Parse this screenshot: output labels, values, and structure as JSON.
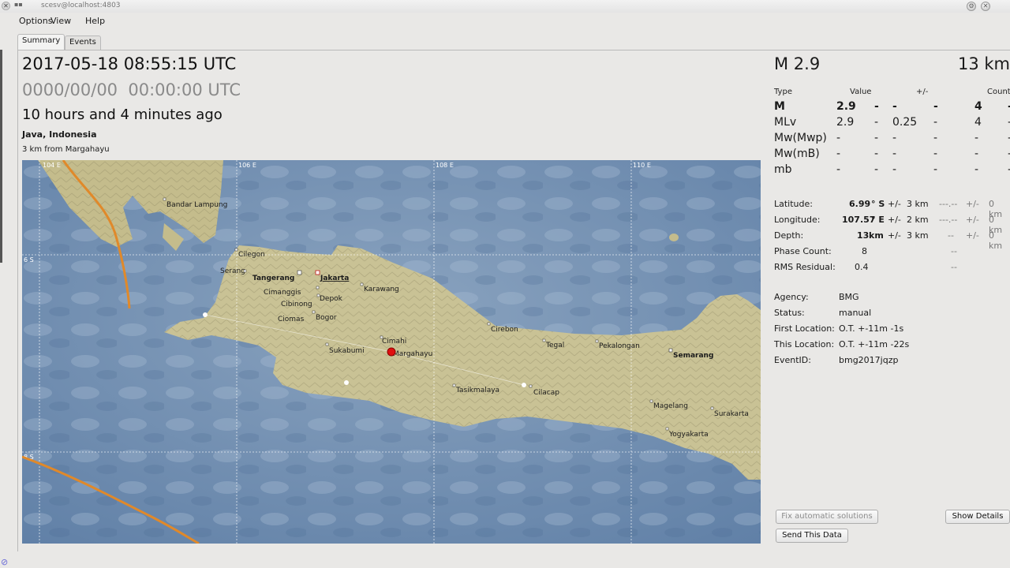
{
  "window": {
    "title": "scesv@localhost:4803",
    "close_glyph": "✕",
    "win_glyphs": [
      "⚙",
      "✕"
    ]
  },
  "menu": [
    "Options",
    "View",
    "Help"
  ],
  "tabs": [
    "Summary",
    "Events"
  ],
  "summary": {
    "origin_time": "2017-05-18 08:55:15 UTC",
    "placeholder_time": "0000/00/00  00:00:00 UTC",
    "elapsed": "10 hours and 4 minutes ago",
    "region": "Java, Indonesia",
    "nearest": "3 km from Margahayu"
  },
  "map": {
    "grid_labels": [
      "104 E",
      "106 E",
      "108 E",
      "110 E",
      "6 S",
      "8 S"
    ],
    "cities": [
      {
        "name": "Bandar Lampung",
        "bold": false
      },
      {
        "name": "Cilegon",
        "bold": false
      },
      {
        "name": "Serang",
        "bold": false
      },
      {
        "name": "Tangerang",
        "bold": true
      },
      {
        "name": "Jakarta",
        "bold": true
      },
      {
        "name": "Cimanggis",
        "bold": false
      },
      {
        "name": "Depok",
        "bold": false
      },
      {
        "name": "Cibinong",
        "bold": false
      },
      {
        "name": "Bogor",
        "bold": false
      },
      {
        "name": "Ciomas",
        "bold": false
      },
      {
        "name": "Karawang",
        "bold": false
      },
      {
        "name": "Sukabumi",
        "bold": false
      },
      {
        "name": "Cimahi",
        "bold": false
      },
      {
        "name": "Margahayu",
        "bold": false
      },
      {
        "name": "Cirebon",
        "bold": false
      },
      {
        "name": "Tegal",
        "bold": false
      },
      {
        "name": "Pekalongan",
        "bold": false
      },
      {
        "name": "Semarang",
        "bold": true
      },
      {
        "name": "Tasikmalaya",
        "bold": false
      },
      {
        "name": "Cilacap",
        "bold": false
      },
      {
        "name": "Magelang",
        "bold": false
      },
      {
        "name": "Surakarta",
        "bold": false
      },
      {
        "name": "Yogyakarta",
        "bold": false
      }
    ],
    "colors": {
      "sea": "#7f9ab7",
      "land": "#c8c192",
      "plate": "#e0892a",
      "epicenter": "#e01010"
    }
  },
  "magnitude": {
    "header": "M 2.9",
    "depth_header": "13 km",
    "columns": {
      "type": "Type",
      "value": "Value",
      "pm": "+/-",
      "count": "Count"
    },
    "rows": [
      {
        "type": "M",
        "value": "2.9",
        "a": "-",
        "b": "-",
        "c": "-",
        "count": "4",
        "d": "-",
        "bold": true
      },
      {
        "type": "MLv",
        "value": "2.9",
        "a": "-",
        "b": "0.25",
        "c": "-",
        "count": "4",
        "d": "-",
        "bold": false
      },
      {
        "type": "Mw(Mwp)",
        "value": "-",
        "a": "-",
        "b": "-",
        "c": "-",
        "count": "-",
        "d": "-",
        "bold": false
      },
      {
        "type": "Mw(mB)",
        "value": "-",
        "a": "-",
        "b": "-",
        "c": "-",
        "count": "-",
        "d": "-",
        "bold": false
      },
      {
        "type": "mb",
        "value": "-",
        "a": "-",
        "b": "-",
        "c": "-",
        "count": "-",
        "d": "-",
        "bold": false
      }
    ]
  },
  "location": {
    "latitude": {
      "label": "Latitude:",
      "value": "6.99",
      "unit": "° S",
      "pm": "+/-",
      "err": "3 km",
      "ref": "---.--",
      "pm2": "+/-",
      "ref_err": "0 km"
    },
    "longitude": {
      "label": "Longitude:",
      "value": "107.57",
      "unit": "° E",
      "pm": "+/-",
      "err": "2 km",
      "ref": "---.--",
      "pm2": "+/-",
      "ref_err": "0 km"
    },
    "depth": {
      "label": "Depth:",
      "value": "13",
      "unit": "km",
      "pm": "+/-",
      "err": "3 km",
      "ref": "--",
      "pm2": "+/-",
      "ref_err": "0 km"
    },
    "phase_count": {
      "label": "Phase Count:",
      "value": "8",
      "ref": "--"
    },
    "rms": {
      "label": "RMS Residual:",
      "value": "0.4",
      "ref": "--"
    }
  },
  "info": {
    "agency": {
      "label": "Agency:",
      "value": "BMG"
    },
    "status": {
      "label": "Status:",
      "value": "manual"
    },
    "first_location": {
      "label": "First Location:",
      "value": "O.T. +-11m -1s"
    },
    "this_location": {
      "label": "This Location:",
      "value": "O.T. +-11m -22s"
    },
    "event_id": {
      "label": "EventID:",
      "value": "bmg2017jqzp"
    }
  },
  "buttons": {
    "fix": "Fix automatic solutions",
    "details": "Show Details",
    "send": "Send This Data"
  }
}
